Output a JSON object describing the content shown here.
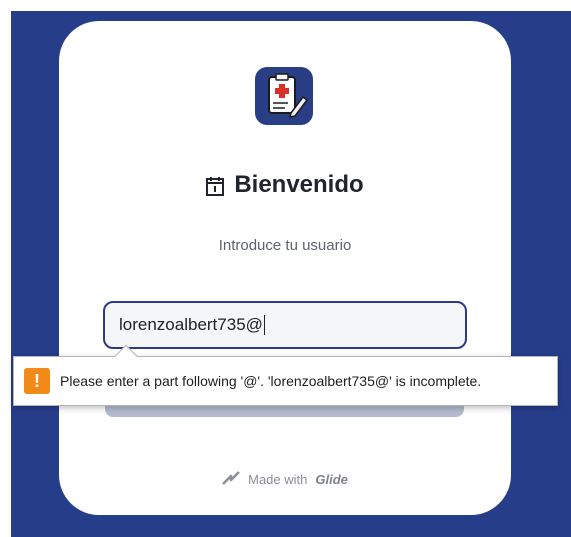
{
  "login": {
    "title": "Bienvenido",
    "subtitle": "Introduce tu usuario",
    "username_value": "lorenzoalbert735@"
  },
  "validation": {
    "message": "Please enter a part following '@'. 'lorenzoalbert735@' is incomplete."
  },
  "footer": {
    "prefix": "Made with",
    "brand": "Glide"
  },
  "icons": {
    "app": "medical-clipboard-icon",
    "title": "calendar-icon",
    "warning": "warning-icon",
    "brand": "glide-logo-icon"
  },
  "colors": {
    "background": "#263d8a",
    "card": "#ffffff",
    "input_border": "#2b3b87",
    "warning": "#f28a1a",
    "button": "#b3bccf"
  }
}
